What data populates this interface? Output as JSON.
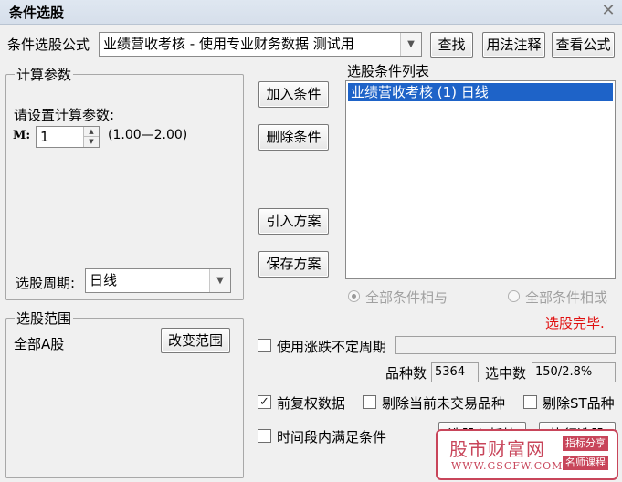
{
  "window": {
    "title": "条件选股",
    "close_glyph": "✕"
  },
  "formula_row": {
    "label": "条件选股公式",
    "combo_value": "业绩营收考核  -  使用专业财务数据 测试用",
    "find_button": "查找",
    "usage_button": "用法注释",
    "view_button": "查看公式"
  },
  "params": {
    "group_title": "计算参数",
    "prompt": "请设置计算参数:",
    "m_label": "M:",
    "m_value": "1",
    "m_range": "(1.00—2.00)",
    "period_label": "选股周期:",
    "period_value": "日线"
  },
  "scope": {
    "group_title": "选股范围",
    "value": "全部A股",
    "change_button": "改变范围"
  },
  "middle_buttons": {
    "add": "加入条件",
    "remove": "删除条件",
    "import_plan": "引入方案",
    "save_plan": "保存方案"
  },
  "conditions": {
    "title": "选股条件列表",
    "items": [
      "业绩营收考核 (1) 日线"
    ]
  },
  "logic": {
    "and_label": "全部条件相与",
    "or_label": "全部条件相或",
    "status": "选股完毕."
  },
  "options": {
    "variable_period_label": "使用涨跌不定周期",
    "variety_count_label": "品种数",
    "variety_count_value": "5364",
    "selected_count_label": "选中数",
    "selected_count_value": "150/2.8%",
    "forward_adjust_label": "前复权数据",
    "exclude_untraded_label": "剔除当前未交易品种",
    "exclude_st_label": "剔除ST品种",
    "time_range_label": "时间段内满足条件",
    "check_glyph": "✓",
    "forward_adjust_checked": true
  },
  "bottom_buttons": {
    "to_board": "选股入板块",
    "execute": "执行选股"
  },
  "watermark": {
    "site_name": "股市财富网",
    "url": "WWW.GSCFW.COM",
    "tag1": "指标分享",
    "tag2": "名师课程"
  },
  "icons": {
    "combo_arrow": "▼",
    "spin_up": "▲",
    "spin_down": "▼"
  },
  "colors": {
    "selection": "#1e63c8",
    "status_red": "#e01010",
    "watermark_red": "#c8455a"
  }
}
